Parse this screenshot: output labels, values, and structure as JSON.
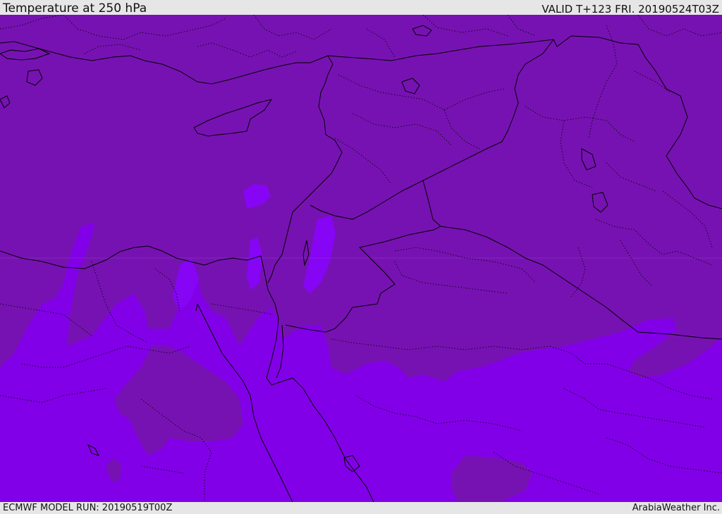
{
  "header": {
    "title": "Temperature at 250 hPa",
    "valid": "VALID T+123 FRI. 20190524T03Z"
  },
  "footer": {
    "model_run": "ECMWF MODEL RUN: 20190519T00Z",
    "credit": "ArabiaWeather Inc."
  },
  "map": {
    "colors": {
      "band_dark": "#7712b2",
      "band_mid": "#8200e8",
      "band_light": "#8605f5",
      "coastline": "#000000",
      "border": "#000000"
    }
  }
}
